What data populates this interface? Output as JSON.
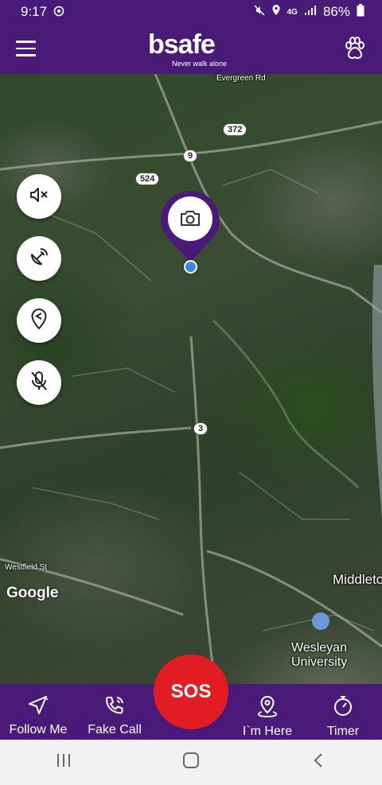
{
  "status_bar": {
    "time": "9:17",
    "battery": "86%",
    "network": "4G",
    "icons": [
      "whatsapp-icon",
      "mute-icon",
      "location-icon",
      "signal-icon",
      "battery-icon"
    ]
  },
  "header": {
    "logo_text": "bsafe",
    "tagline": "Never walk alone",
    "menu_icon": "hamburger-icon",
    "right_icon": "paw-icon"
  },
  "map": {
    "labels": {
      "evergreen": "Evergreen Rd",
      "westfield": "Westfield St",
      "middletown": "Middleto",
      "wesleyan_1": "Wesleyan",
      "wesleyan_2": "University",
      "google": "Google"
    },
    "shields": {
      "r372": "372",
      "r9": "9",
      "r524": "524",
      "r3": "3"
    },
    "pin_icon": "camera-icon"
  },
  "side_controls": [
    {
      "name": "volume-mute",
      "icon": "speaker-off-icon"
    },
    {
      "name": "satellite",
      "icon": "satellite-icon"
    },
    {
      "name": "share-location",
      "icon": "share-location-icon"
    },
    {
      "name": "microphone-off",
      "icon": "mic-off-icon"
    }
  ],
  "bottom_nav": {
    "follow_me": "Follow Me",
    "fake_call": "Fake Call",
    "sos": "SOS",
    "im_here": "I`m Here",
    "timer": "Timer"
  },
  "colors": {
    "brand_purple": "#4a1a78",
    "sos_red": "#e31b23",
    "location_blue": "#3a86e0"
  }
}
